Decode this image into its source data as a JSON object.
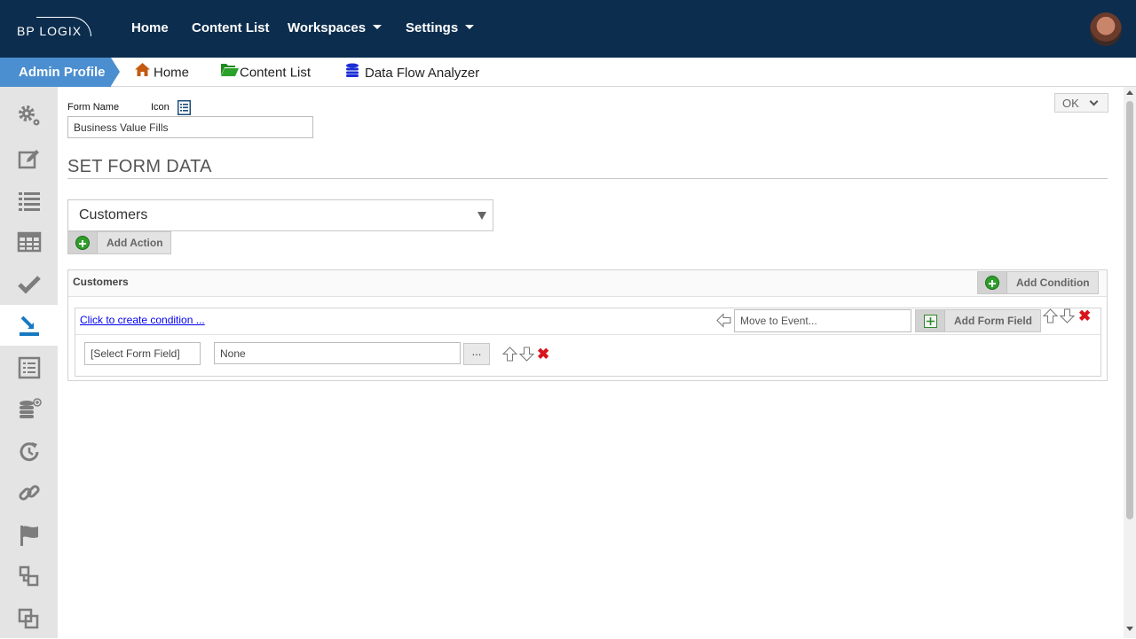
{
  "header": {
    "logo_text": "BP LOGIX",
    "nav": [
      {
        "label": "Home"
      },
      {
        "label": "Content List"
      },
      {
        "label": "Workspaces"
      },
      {
        "label": "Settings"
      }
    ]
  },
  "breadcrumb": {
    "admin_profile": "Admin Profile",
    "items": [
      {
        "label": "Home",
        "icon": "home-icon",
        "color": "#c45a10"
      },
      {
        "label": "Content List",
        "icon": "folder-open-icon",
        "color": "#1f8a1f"
      },
      {
        "label": "Data Flow Analyzer",
        "icon": "database-icon",
        "color": "#1c2fd6"
      }
    ]
  },
  "sidebar": {
    "items": [
      "gears-icon",
      "edit-icon",
      "list-icon",
      "table-icon",
      "check-icon",
      "form-data-icon",
      "document-list-icon",
      "database-add-icon",
      "refresh-clock-icon",
      "link-icon",
      "flag-icon",
      "workflow-icon",
      "copy-icon"
    ],
    "active_index": 5
  },
  "form": {
    "form_name_label": "Form Name",
    "icon_label": "Icon",
    "form_name_value": "Business Value Fills",
    "ok_label": "OK",
    "section_title": "SET FORM DATA",
    "target_select": "Customers",
    "add_action_label": "Add Action"
  },
  "panel": {
    "title": "Customers",
    "add_condition_label": "Add Condition",
    "create_condition_link": "Click to create condition ...",
    "move_to_event_placeholder": "Move to Event...",
    "add_form_field_label": "Add Form Field",
    "field_row": {
      "select_field": "[Select Form Field]",
      "value": "None",
      "ellipsis": "..."
    }
  },
  "colors": {
    "topnav": "#0c2d4e",
    "admin_tab": "#4b8fd0",
    "sidebar": "#e4e4e4",
    "delete": "#d9141b",
    "add": "#2e9e2a"
  }
}
